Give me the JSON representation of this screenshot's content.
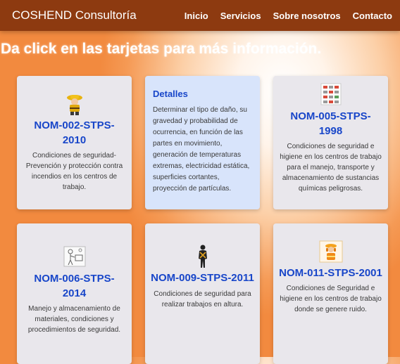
{
  "navbar": {
    "brand": "COSHEND Consultoría",
    "links": [
      "Inicio",
      "Servicios",
      "Sobre nosotros",
      "Contacto"
    ]
  },
  "headline": "Da click en las tarjetas para más información.",
  "cards": [
    {
      "title": "NOM-002-STPS-2010",
      "description": "Condiciones de seguridad-Prevención y protección contra incendios en los centros de trabajo.",
      "icon": "firefighter-icon"
    },
    {
      "title": "Detalles",
      "description": "Determinar el tipo de daño, su gravedad y probabilidad de ocurrencia, en función de las partes en movimiento, generación de temperaturas extremas, electricidad estática, superficies cortantes, proyección de partículas."
    },
    {
      "title": "NOM-005-STPS-1998",
      "description": "Condiciones de seguridad e higiene en los centros de trabajo para el manejo, transporte y almacenamiento de sustancias químicas peligrosas.",
      "icon": "hazard-chart-icon"
    },
    {
      "title": "NOM-006-STPS-2014",
      "description": "Manejo y almacenamiento de materiales, condiciones y procedimientos de seguridad.",
      "icon": "workers-sketch-icon"
    },
    {
      "title": "NOM-009-STPS-2011",
      "description": "Condiciones de seguridad para realizar trabajos en altura.",
      "icon": "harness-icon"
    },
    {
      "title": "NOM-011-STPS-2001",
      "description": "Condiciones de Seguridad e higiene en los centros de trabajo donde se genere ruido.",
      "icon": "noise-worker-icon"
    }
  ]
}
